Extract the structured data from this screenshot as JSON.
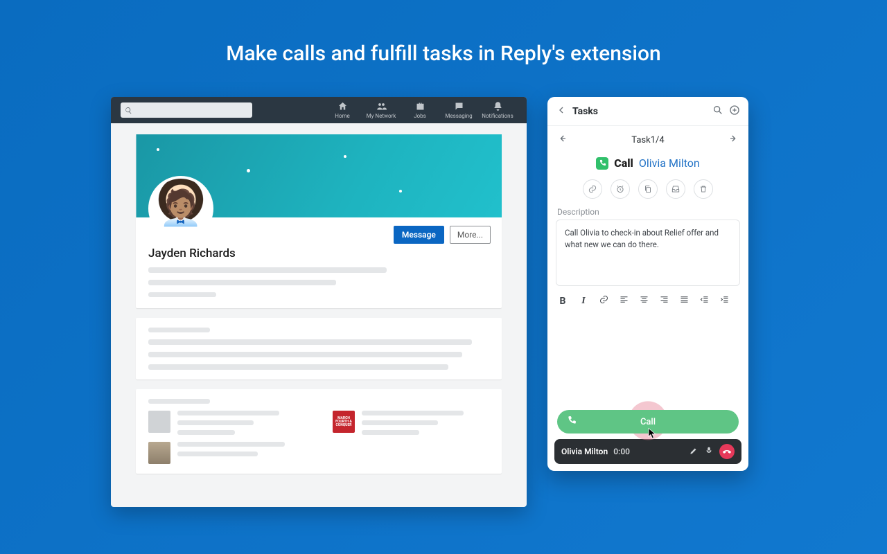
{
  "heading": "Make calls and fulfill tasks in Reply's extension",
  "linkedin": {
    "nav": {
      "items": [
        {
          "name": "home",
          "label": "Home"
        },
        {
          "name": "network",
          "label": "My Network"
        },
        {
          "name": "jobs",
          "label": "Jobs"
        },
        {
          "name": "messaging",
          "label": "Messaging"
        },
        {
          "name": "notifications",
          "label": "Notifications"
        }
      ]
    },
    "message_btn": "Message",
    "more_btn": "More...",
    "profile_name": "Jayden Richards",
    "exp_badge": "MARCH FOURTH & CONQUER"
  },
  "ext": {
    "title": "Tasks",
    "pager": "Task1/4",
    "call_word": "Call",
    "call_name": "Olivia Milton",
    "desc_label": "Description",
    "desc_text": "Call Olivia to check-in about Relief offer and what new we can do there.",
    "call_btn": "Call",
    "dial_name": "Olivia Milton",
    "dial_time": "0:00"
  }
}
